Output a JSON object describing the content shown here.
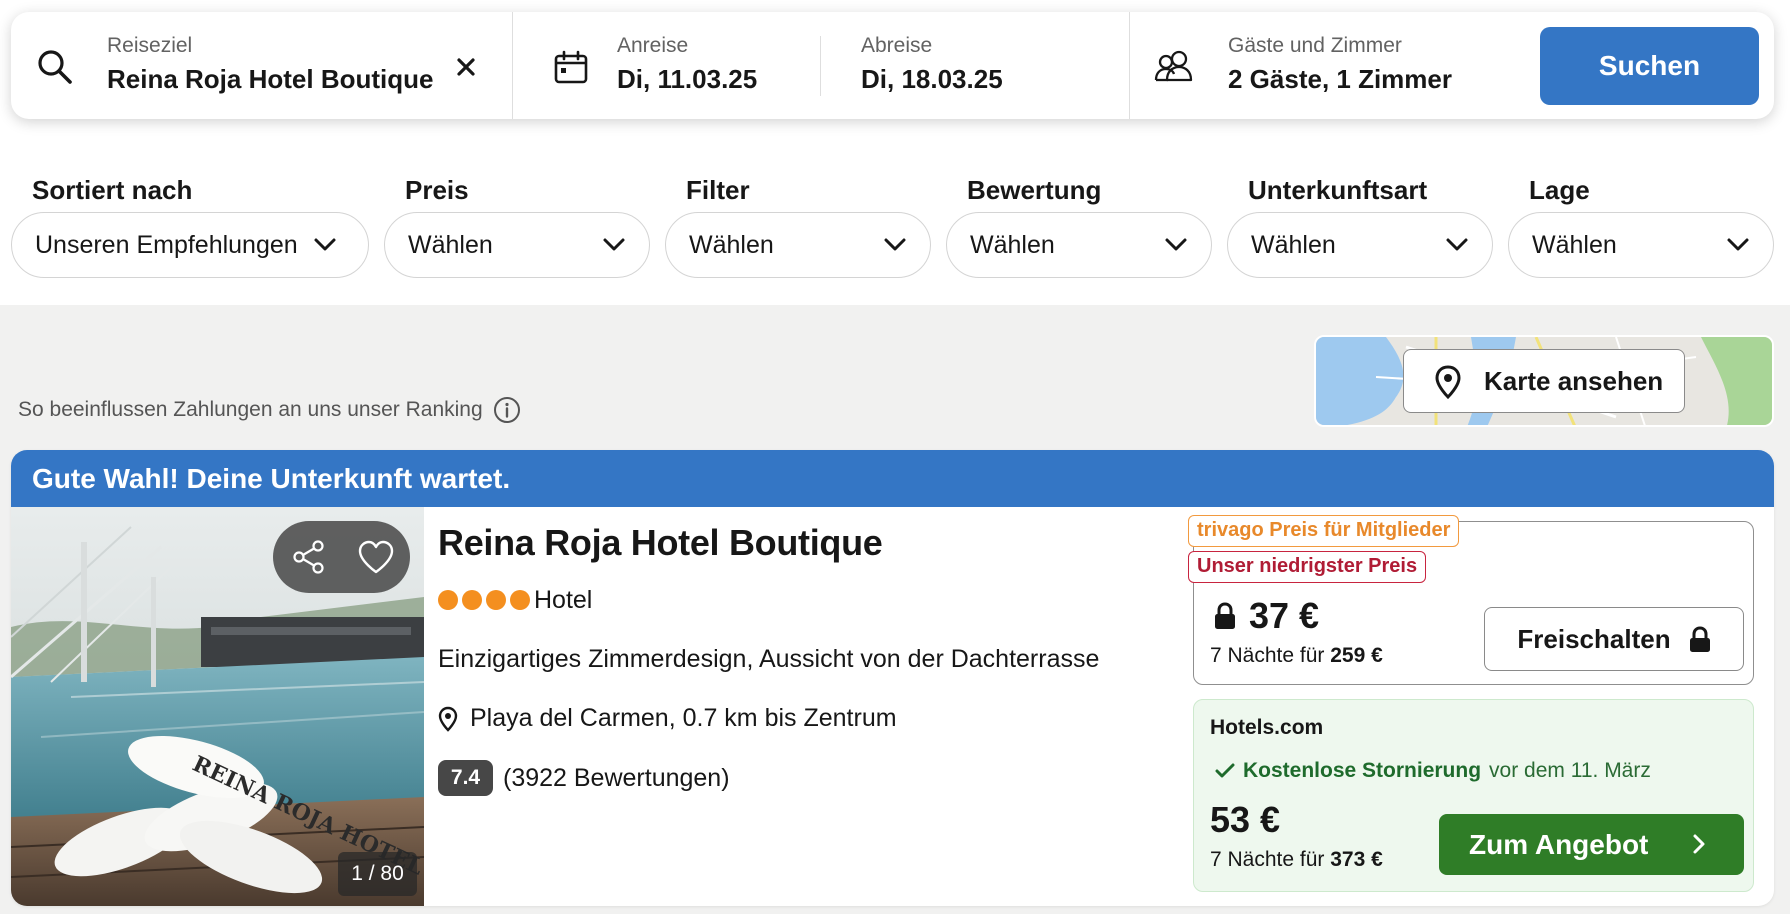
{
  "search": {
    "destination_label": "Reiseziel",
    "destination_value": "Reina Roja Hotel Boutique",
    "checkin_label": "Anreise",
    "checkin_value": "Di, 11.03.25",
    "checkout_label": "Abreise",
    "checkout_value": "Di, 18.03.25",
    "guests_label": "Gäste und Zimmer",
    "guests_value": "2 Gäste, 1 Zimmer",
    "search_button": "Suchen"
  },
  "filters": [
    {
      "label": "Sortiert nach",
      "value": "Unseren Empfehlungen"
    },
    {
      "label": "Preis",
      "value": "Wählen"
    },
    {
      "label": "Filter",
      "value": "Wählen"
    },
    {
      "label": "Bewertung",
      "value": "Wählen"
    },
    {
      "label": "Unterkunftsart",
      "value": "Wählen"
    },
    {
      "label": "Lage",
      "value": "Wählen"
    }
  ],
  "ranking_note": "So beeinflussen Zahlungen an uns unser Ranking",
  "map": {
    "button_label": "Karte ansehen"
  },
  "result": {
    "banner": "Gute Wahl! Deine Unterkunft wartet.",
    "name": "Reina Roja Hotel Boutique",
    "stars": 4,
    "type": "Hotel",
    "highlights": "Einzigartiges Zimmerdesign, Aussicht von der Dachterrasse",
    "location": "Playa del Carmen, 0.7 km bis Zentrum",
    "rating_score": "7.4",
    "rating_count": "(3922 Bewertungen)",
    "photo_counter": "1 / 80",
    "photo_towel_text": "REINA ROJA HOTEL",
    "member_badge": "trivago Preis für Mitglieder",
    "lowest_badge": "Unser niedrigster Preis",
    "member_price": "37 €",
    "member_nights_prefix": "7 Nächte für",
    "member_nights_total": "259 €",
    "unlock_button": "Freischalten",
    "offer": {
      "provider": "Hotels.com",
      "cancellation_strong": "Kostenlose Stornierung",
      "cancellation_rest": "vor dem 11. März",
      "price": "53 €",
      "nights_prefix": "7 Nächte für",
      "nights_total": "373 €",
      "button": "Zum Angebot"
    }
  },
  "colors": {
    "brand_blue": "#3476c5",
    "offer_green": "#2f7d27",
    "star_orange": "#f48f1f",
    "badge_orange": "#e8892b",
    "badge_red": "#b01c35"
  },
  "icons": [
    "search-icon",
    "clear-icon",
    "calendar-icon",
    "guests-icon",
    "chevron-down-icon",
    "info-icon",
    "map-pin-icon",
    "share-icon",
    "heart-icon",
    "lock-icon",
    "check-icon",
    "chevron-right-icon"
  ]
}
